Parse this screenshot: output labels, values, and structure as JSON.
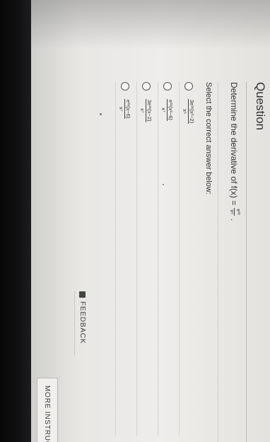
{
  "question": {
    "heading": "Question",
    "prompt_prefix": "Determine the derivative of f(x) = ",
    "prompt_fraction": {
      "numerator": "e³ˣ",
      "denominator": "x⁶"
    },
    "prompt_suffix": "."
  },
  "select_label": "Select the correct answer below:",
  "answers": [
    {
      "numerator": "3e³ˣ(x²−2)",
      "denominator": "x⁶"
    },
    {
      "numerator": "e³ˣ(x²−6)",
      "denominator": "x⁷"
    },
    {
      "numerator": "3e³ˣ(x−2)",
      "denominator": "x⁷"
    },
    {
      "numerator": "e³ˣ(x−6)",
      "denominator": "x⁷"
    }
  ],
  "feedback_label": "FEEDBACK",
  "more_button_label": "MORE INSTRUCT"
}
